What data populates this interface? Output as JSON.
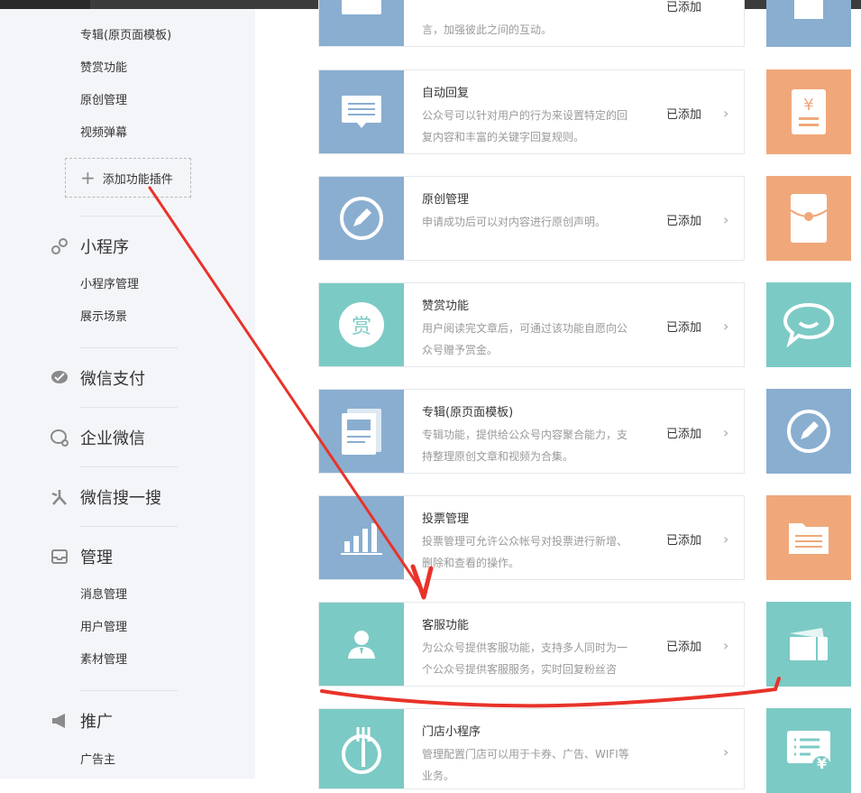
{
  "sidebar": {
    "plugin_items": [
      "专辑(原页面模板)",
      "赞赏功能",
      "原创管理",
      "视频弹幕"
    ],
    "add_plugin_label": "添加功能插件",
    "miniprogram": {
      "title": "小程序",
      "items": [
        "小程序管理",
        "展示场景"
      ]
    },
    "wechat_pay": {
      "title": "微信支付"
    },
    "work_wechat": {
      "title": "企业微信"
    },
    "search": {
      "title": "微信搜一搜"
    },
    "manage": {
      "title": "管理",
      "items": [
        "消息管理",
        "用户管理",
        "素材管理"
      ]
    },
    "promote": {
      "title": "推广",
      "items": [
        "广告主"
      ]
    }
  },
  "cards": [
    {
      "title": "",
      "desc": "言，加强彼此之间的互动。",
      "status": "已添加",
      "icon": "message-icon",
      "color": "#8aaed0"
    },
    {
      "title": "自动回复",
      "desc": "公众号可以针对用户的行为来设置特定的回复内容和丰富的关键字回复规则。",
      "status": "已添加",
      "icon": "chat-list-icon",
      "color": "#8aaed0"
    },
    {
      "title": "原创管理",
      "desc": "申请成功后可以对内容进行原创声明。",
      "status": "已添加",
      "icon": "pencil-circle-icon",
      "color": "#8aaed0"
    },
    {
      "title": "赞赏功能",
      "desc": "用户阅读完文章后，可通过该功能自愿向公众号赠予赏金。",
      "status": "已添加",
      "icon": "reward-icon",
      "color": "#7ccac5",
      "icon_text": "赏"
    },
    {
      "title": "专辑(原页面模板)",
      "desc": "专辑功能，提供给公众号内容聚合能力，支持整理原创文章和视频为合集。",
      "status": "已添加",
      "icon": "album-icon",
      "color": "#8aaed0"
    },
    {
      "title": "投票管理",
      "desc": "投票管理可允许公众帐号对投票进行新增、删除和查看的操作。",
      "status": "已添加",
      "icon": "bar-chart-icon",
      "color": "#8aaed0"
    },
    {
      "title": "客服功能",
      "desc": "为公众号提供客服功能，支持多人同时为一个公众号提供客服服务，实时回复粉丝咨",
      "status": "已添加",
      "icon": "customer-service-icon",
      "color": "#7ccac5"
    },
    {
      "title": "门店小程序",
      "desc": "管理配置门店可以用于卡券、广告、WIFI等业务。",
      "status": "",
      "icon": "store-icon",
      "color": "#7ccac5"
    }
  ],
  "right_column": [
    {
      "icon": "document-icon",
      "color": "#8aaed0"
    },
    {
      "icon": "receipt-yuan-icon",
      "color": "#f0a87a",
      "icon_text": "¥"
    },
    {
      "icon": "red-envelope-icon",
      "color": "#f0a87a"
    },
    {
      "icon": "speech-bubble-icon",
      "color": "#7ccac5"
    },
    {
      "icon": "pencil-circle-icon",
      "color": "#8aaed0"
    },
    {
      "icon": "folder-list-icon",
      "color": "#f0a87a"
    },
    {
      "icon": "card-wallet-icon",
      "color": "#7ccac5"
    },
    {
      "icon": "ticket-yuan-icon",
      "color": "#7ccac5",
      "icon_text": "¥"
    }
  ],
  "chevron": "›",
  "annotation_colors": {
    "red": "#e8332a"
  }
}
